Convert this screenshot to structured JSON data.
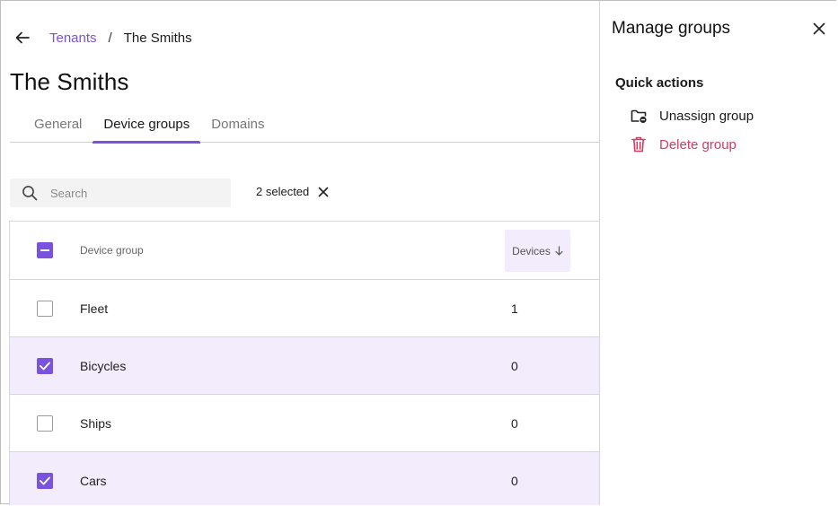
{
  "breadcrumb": {
    "parent": "Tenants",
    "separator": "/",
    "current": "The Smiths"
  },
  "page_title": "The Smiths",
  "tabs": [
    {
      "label": "General",
      "active": false
    },
    {
      "label": "Device groups",
      "active": true
    },
    {
      "label": "Domains",
      "active": false
    }
  ],
  "search": {
    "placeholder": "Search",
    "value": ""
  },
  "selection": {
    "label": "2 selected"
  },
  "table": {
    "headers": {
      "name": "Device group",
      "devices": "Devices"
    },
    "sort": {
      "column": "Devices",
      "direction": "descending"
    },
    "rows": [
      {
        "name": "Fleet",
        "devices": "1",
        "selected": false
      },
      {
        "name": "Bicycles",
        "devices": "0",
        "selected": true
      },
      {
        "name": "Ships",
        "devices": "0",
        "selected": false
      },
      {
        "name": "Cars",
        "devices": "0",
        "selected": true
      }
    ]
  },
  "side_panel": {
    "title": "Manage groups",
    "quick_actions_title": "Quick actions",
    "actions": [
      {
        "label": "Unassign group",
        "icon": "folder-minus-icon"
      },
      {
        "label": "Delete group",
        "icon": "trash-icon"
      }
    ]
  },
  "colors": {
    "accent": "#7a52e0",
    "selected_row": "#f2ecfd",
    "danger": "#d23b62"
  }
}
